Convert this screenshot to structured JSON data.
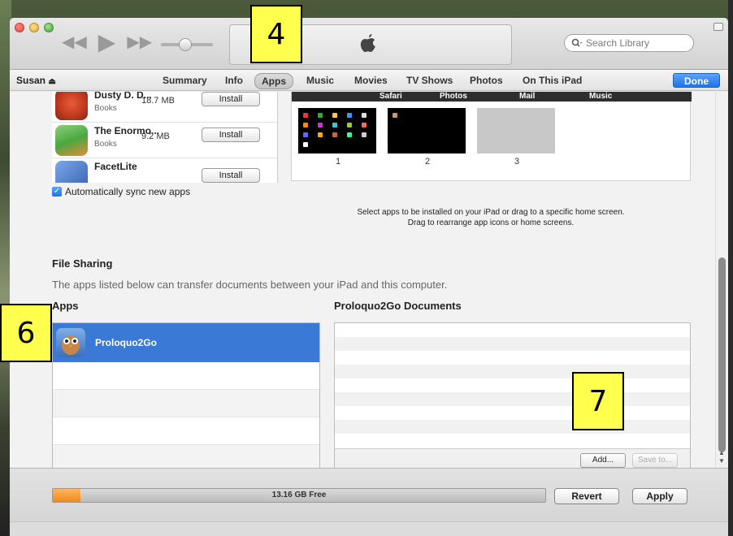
{
  "toolbar": {
    "search_placeholder": "Search Library",
    "transport": {
      "rewind": "◀◀",
      "play": "▶",
      "forward": "▶▶"
    }
  },
  "device": {
    "name": "Susan",
    "eject": "⏏"
  },
  "nav_tabs": [
    {
      "label": "Summary"
    },
    {
      "label": "Info"
    },
    {
      "label": "Apps",
      "active": true
    },
    {
      "label": "Music"
    },
    {
      "label": "Movies"
    },
    {
      "label": "TV Shows"
    },
    {
      "label": "Photos"
    },
    {
      "label": "On This iPad"
    }
  ],
  "done_label": "Done",
  "app_list": [
    {
      "name": "Dusty D. D...",
      "category": "Books",
      "size": "18.7 MB",
      "action": "Install",
      "icon": "dusty-app-icon"
    },
    {
      "name": "The Enormo...",
      "category": "Books",
      "size": "9.2 MB",
      "action": "Install",
      "icon": "enormous-crocodile-app-icon"
    },
    {
      "name": "FacetLite",
      "category": "",
      "size": "",
      "action": "Install",
      "icon": "facetlite-app-icon"
    }
  ],
  "auto_sync_label": "Automatically sync new apps",
  "dock_labels": [
    "Safari",
    "Photos",
    "Mail",
    "Music"
  ],
  "home_screens": [
    "1",
    "2",
    "3"
  ],
  "home_screen_help": [
    "Select apps to be installed on your iPad or drag to a specific home screen.",
    "Drag to rearrange app icons or home screens."
  ],
  "file_sharing": {
    "title": "File Sharing",
    "description": "The apps listed below can transfer documents between your iPad and this computer.",
    "apps_header": "Apps",
    "docs_header": "Proloquo2Go Documents",
    "apps": [
      {
        "name": "Proloquo2Go",
        "selected": true
      }
    ],
    "add_label": "Add...",
    "save_label": "Save to..."
  },
  "capacity": {
    "free_label": "13.16 GB Free"
  },
  "buttons": {
    "revert": "Revert",
    "apply": "Apply"
  },
  "callouts": {
    "c4": "4",
    "c6": "6",
    "c7": "7"
  },
  "colors": {
    "accent_blue": "#3a79d6",
    "done_blue": "#1f74e8",
    "callout_yellow": "#ffff4d",
    "capacity_orange": "#f08a1c"
  }
}
